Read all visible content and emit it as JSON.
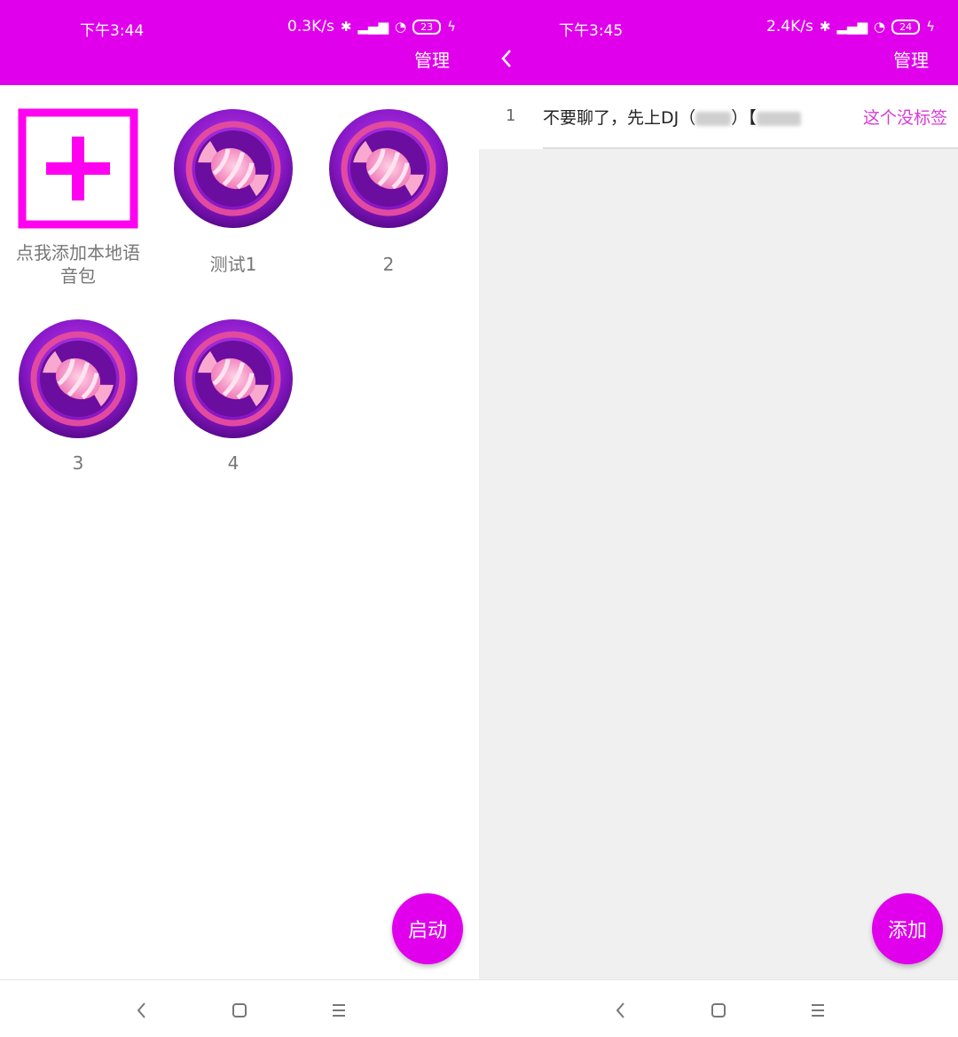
{
  "left": {
    "status": {
      "time": "下午3:44",
      "speed": "0.3K/s",
      "battery": "23"
    },
    "header": {
      "manage_label": "管理"
    },
    "add_item": {
      "label_line1": "点我添加本地语",
      "label_line2": "音包"
    },
    "items": [
      {
        "label": "测试1"
      },
      {
        "label": "2"
      },
      {
        "label": "3"
      },
      {
        "label": "4"
      }
    ],
    "fab_label": "启动"
  },
  "right": {
    "status": {
      "time": "下午3:45",
      "speed": "2.4K/s",
      "battery": "24"
    },
    "header": {
      "manage_label": "管理"
    },
    "list": [
      {
        "index": "1",
        "title": "不要聊了，先上DJ（",
        "title_mid": "）【",
        "tag": "这个没标签"
      }
    ],
    "fab_label": "添加"
  },
  "colors": {
    "accent": "#e000ec",
    "tag_text": "#d63bd9",
    "list_bg": "#f0f0f0"
  },
  "icons": [
    "back-icon",
    "add-icon",
    "candy-icon",
    "nav-back-icon",
    "nav-home-icon",
    "nav-menu-icon"
  ]
}
